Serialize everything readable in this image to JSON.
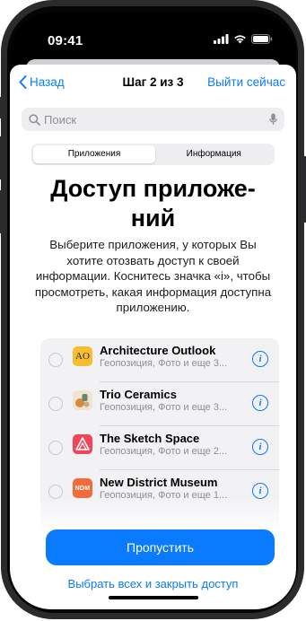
{
  "status_bar": {
    "time": "09:41"
  },
  "nav": {
    "back_label": "Назад",
    "step_label": "Шаг 2 из 3",
    "exit_label": "Выйти сейчас"
  },
  "search": {
    "placeholder": "Поиск"
  },
  "segmented": {
    "options": [
      "Приложения",
      "Информация"
    ],
    "selected": "Приложения"
  },
  "main": {
    "title_line1": "Доступ приложе-",
    "title_line2": "ний",
    "description": "Выберите приложения, у которых Вы хотите отозвать доступ к своей информации. Коснитесь значка «i», чтобы просмотреть, какая информация доступна приложению."
  },
  "apps": [
    {
      "name": "Architecture Outlook",
      "subtitle": "Геопозиция, Фото и еще 3...",
      "icon_text": "AO",
      "icon": "architecture-outlook-icon"
    },
    {
      "name": "Trio Ceramics",
      "subtitle": "Геопозиция, Фото и еще 3...",
      "icon": "trio-ceramics-icon"
    },
    {
      "name": "The Sketch Space",
      "subtitle": "Геопозиция, Фото и еще 2...",
      "icon": "sketch-space-icon"
    },
    {
      "name": "New District Museum",
      "subtitle": "Геопозиция, Фото и еще 1...",
      "icon_text": "NDM",
      "icon": "new-district-museum-icon"
    }
  ],
  "actions": {
    "primary_label": "Пропустить",
    "secondary_label": "Выбрать всех и закрыть доступ"
  },
  "colors": {
    "accent": "#0a7aff",
    "list_bg": "#f2f2f5"
  }
}
